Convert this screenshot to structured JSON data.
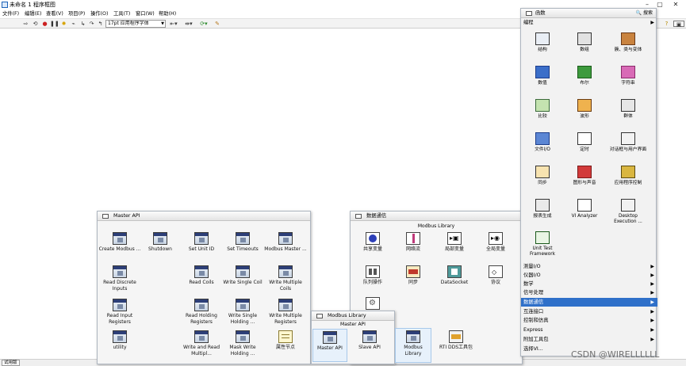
{
  "window": {
    "title": "未命名 1 程序框图"
  },
  "menubar": [
    "文件(F)",
    "编辑(E)",
    "查看(V)",
    "项目(P)",
    "操作(O)",
    "工具(T)",
    "窗口(W)",
    "帮助(H)"
  ],
  "toolbar": {
    "font": "17pt 应用程序字体"
  },
  "statusbar": {
    "tag": "试用版"
  },
  "master_api": {
    "title": "Master API",
    "items": [
      {
        "label": "Create Modbus ..."
      },
      {
        "label": "Shutdown"
      },
      {
        "label": "Set Unit ID"
      },
      {
        "label": "Set Timeouts"
      },
      {
        "label": "Modbus Master ..."
      },
      {
        "label": "Read Discrete Inputs"
      },
      {
        "label": "Read Coils"
      },
      {
        "label": "Write Single Coil"
      },
      {
        "label": "Write Multiple Coils"
      },
      {
        "label": "Read Input Registers"
      },
      {
        "label": "Read Holding Registers"
      },
      {
        "label": "Write Single Holding ..."
      },
      {
        "label": "Write Multiple Registers"
      },
      {
        "label": "utility"
      },
      {
        "label": "Write and Read Multipl..."
      },
      {
        "label": "Mask Write Holding ..."
      },
      {
        "label": "属性节点"
      }
    ]
  },
  "data_comm": {
    "title": "数据通信",
    "subtitle": "Modbus Library",
    "items": [
      {
        "label": "共享变量"
      },
      {
        "label": "网络流"
      },
      {
        "label": "局部变量"
      },
      {
        "label": "全局变量"
      },
      {
        "label": "队列操作"
      },
      {
        "label": "同步"
      },
      {
        "label": "DataSocket"
      },
      {
        "label": "协议"
      },
      {
        "label": ""
      },
      {
        "label": "RTI DDS工具包"
      }
    ]
  },
  "modbus_lib": {
    "title": "Modbus Library",
    "subtitle": "Master API",
    "items": [
      {
        "label": "Master API"
      },
      {
        "label": "Slave API"
      },
      {
        "label": "Modbus Library"
      }
    ]
  },
  "functions": {
    "title": "函数",
    "search": "搜索",
    "programming": "编程",
    "items": [
      {
        "label": "结构"
      },
      {
        "label": "数组"
      },
      {
        "label": "簇、类与变体"
      },
      {
        "label": "数值"
      },
      {
        "label": "布尔"
      },
      {
        "label": "字符串"
      },
      {
        "label": "比较"
      },
      {
        "label": "波形"
      },
      {
        "label": "群体"
      },
      {
        "label": "文件I/O"
      },
      {
        "label": "定时"
      },
      {
        "label": "对话框与用户界面"
      },
      {
        "label": "同步"
      },
      {
        "label": "图形与声音"
      },
      {
        "label": "应用程序控制"
      },
      {
        "label": "报表生成"
      },
      {
        "label": "VI Analyzer"
      },
      {
        "label": "Desktop Execution ..."
      },
      {
        "label": "Unit Test Framework"
      }
    ],
    "categories": [
      {
        "label": "测量I/O"
      },
      {
        "label": "仪器I/O"
      },
      {
        "label": "数学"
      },
      {
        "label": "信号处理"
      },
      {
        "label": "数据通信"
      },
      {
        "label": "互连接口"
      },
      {
        "label": "控制和仿真"
      },
      {
        "label": "Express"
      },
      {
        "label": "附加工具包"
      },
      {
        "label": "选择VI..."
      }
    ],
    "active_category": "数据通信"
  },
  "watermark": "CSDN @WIRELLLLLL",
  "colors": {
    "selection": "#2f70c9",
    "vi_header": "#2d3f78",
    "palette_bg": "#f5f5f5"
  }
}
